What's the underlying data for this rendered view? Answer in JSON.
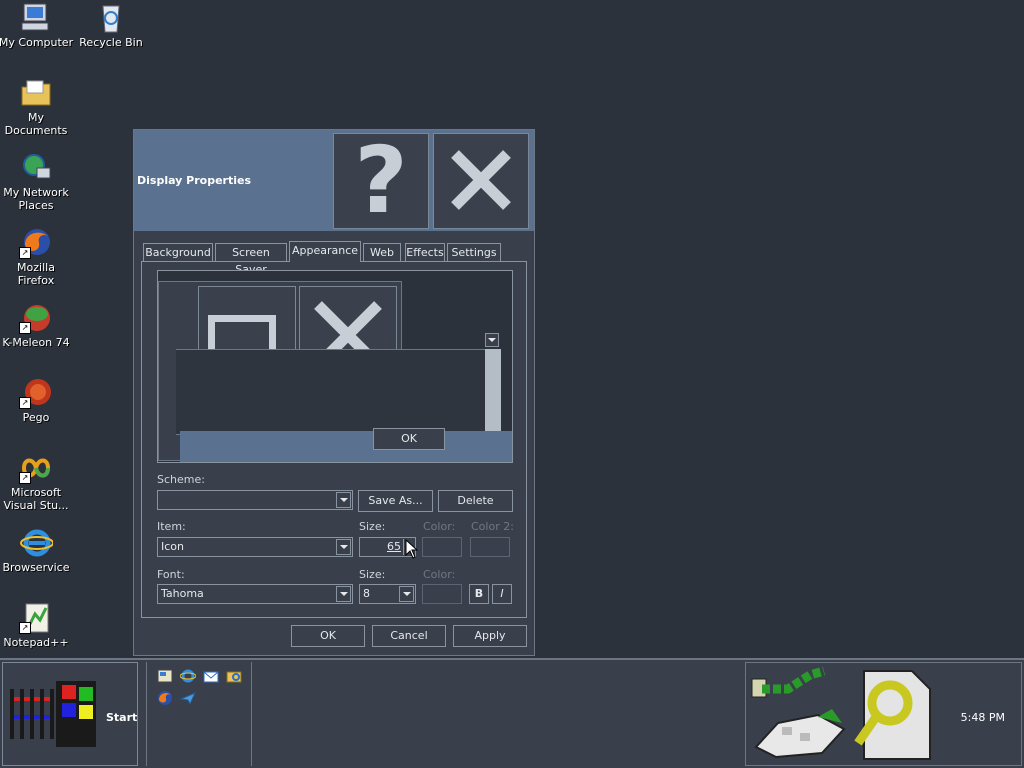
{
  "desktop": {
    "icons": [
      {
        "label": "My Computer"
      },
      {
        "label": "Recycle Bin"
      },
      {
        "label": "My Documents"
      },
      {
        "label": "My Network\nPlaces"
      },
      {
        "label": "Mozilla Firefox"
      },
      {
        "label": "K-Meleon 74"
      },
      {
        "label": "Pego"
      },
      {
        "label": "Microsoft\nVisual Stu..."
      },
      {
        "label": "Browservice"
      },
      {
        "label": "Notepad++"
      }
    ]
  },
  "dialog": {
    "title": "Display Properties",
    "title_buttons": {
      "help": "?",
      "close": "✕"
    },
    "tabs": [
      "Background",
      "Screen Saver",
      "Appearance",
      "Web",
      "Effects",
      "Settings"
    ],
    "active_tab": "Appearance",
    "preview": {
      "ok_label": "OK"
    },
    "scheme": {
      "label": "Scheme:",
      "value": "",
      "save_as": "Save As...",
      "delete": "Delete"
    },
    "item": {
      "label": "Item:",
      "value": "Icon",
      "size_label": "Size:",
      "size_value": "65",
      "color_label": "Color:",
      "color2_label": "Color 2:"
    },
    "font": {
      "label": "Font:",
      "value": "Tahoma",
      "size_label": "Size:",
      "size_value": "8",
      "color_label": "Color:",
      "bold": "B",
      "italic": "I"
    },
    "buttons": {
      "ok": "OK",
      "cancel": "Cancel",
      "apply": "Apply"
    }
  },
  "taskbar": {
    "start_label": "Start",
    "clock": "5:48 PM"
  },
  "colors": {
    "desktop": "#2c323c",
    "title_active": "#5a7190",
    "window_face": "#39404b"
  }
}
